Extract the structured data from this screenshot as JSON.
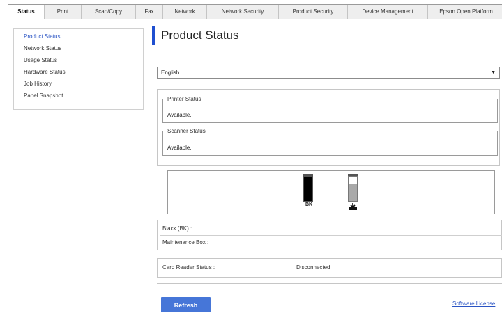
{
  "tabs": [
    {
      "label": "Status",
      "active": true
    },
    {
      "label": "Print"
    },
    {
      "label": "Scan/Copy"
    },
    {
      "label": "Fax"
    },
    {
      "label": "Network"
    },
    {
      "label": "Network Security"
    },
    {
      "label": "Product Security"
    },
    {
      "label": "Device Management"
    },
    {
      "label": "Epson Open Platform"
    }
  ],
  "sidebar": {
    "items": [
      {
        "label": "Product Status",
        "active": true
      },
      {
        "label": "Network Status"
      },
      {
        "label": "Usage Status"
      },
      {
        "label": "Hardware Status"
      },
      {
        "label": "Job History"
      },
      {
        "label": "Panel Snapshot"
      }
    ]
  },
  "main": {
    "title": "Product Status",
    "language_select": {
      "value": "English",
      "arrow_icon": "triangle-down-icon"
    },
    "printer_status": {
      "legend": "Printer Status",
      "value": "Available."
    },
    "scanner_status": {
      "legend": "Scanner Status",
      "value": "Available."
    },
    "ink": {
      "black_label": "BK",
      "black_level": 1.0,
      "maintenance_level": 0.7,
      "maintenance_icon": "maintenance-box-icon",
      "black_color": "#000000",
      "maintenance_color": "#a9a9a9"
    },
    "details": {
      "black": "Black (BK) :",
      "maintenance": "Maintenance Box :"
    },
    "card_reader": {
      "label": "Card Reader Status :",
      "value": "Disconnected"
    },
    "refresh_label": "Refresh",
    "license_link": "Software License"
  },
  "colors": {
    "accent": "#1f4fd0",
    "button": "#4676d8",
    "link": "#2a54c4"
  }
}
